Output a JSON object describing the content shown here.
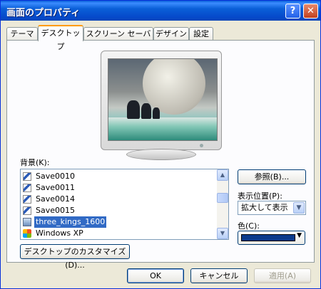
{
  "window": {
    "title": "画面のプロパティ"
  },
  "titlebar": {
    "help_label": "?",
    "close_label": "✕"
  },
  "tabs": [
    {
      "label": "テーマ"
    },
    {
      "label": "デスクトップ"
    },
    {
      "label": "スクリーン セーバー"
    },
    {
      "label": "デザイン"
    },
    {
      "label": "設定"
    }
  ],
  "active_tab": "デスクトップ",
  "background": {
    "label": "背景(K):",
    "items": [
      {
        "label": "Save0010",
        "icon": "pen-icon"
      },
      {
        "label": "Save0011",
        "icon": "pen-icon"
      },
      {
        "label": "Save0014",
        "icon": "pen-icon"
      },
      {
        "label": "Save0015",
        "icon": "pen-icon"
      },
      {
        "label": "three_kings_1600",
        "icon": "image-icon",
        "selected": true
      },
      {
        "label": "Windows XP",
        "icon": "windows-logo-icon"
      }
    ]
  },
  "browse_button": "参照(B)...",
  "position": {
    "label": "表示位置(P):",
    "value": "拡大して表示"
  },
  "color": {
    "label": "色(C):",
    "value": "#0a3a8c"
  },
  "customize_button": "デスクトップのカスタマイズ(D)...",
  "footer": {
    "ok": "OK",
    "cancel": "キャンセル",
    "apply": "適用(A)"
  },
  "colors": {
    "titlebar": "#0a5fd8",
    "selection": "#316ac5",
    "tab_highlight": "#ff9b00"
  }
}
